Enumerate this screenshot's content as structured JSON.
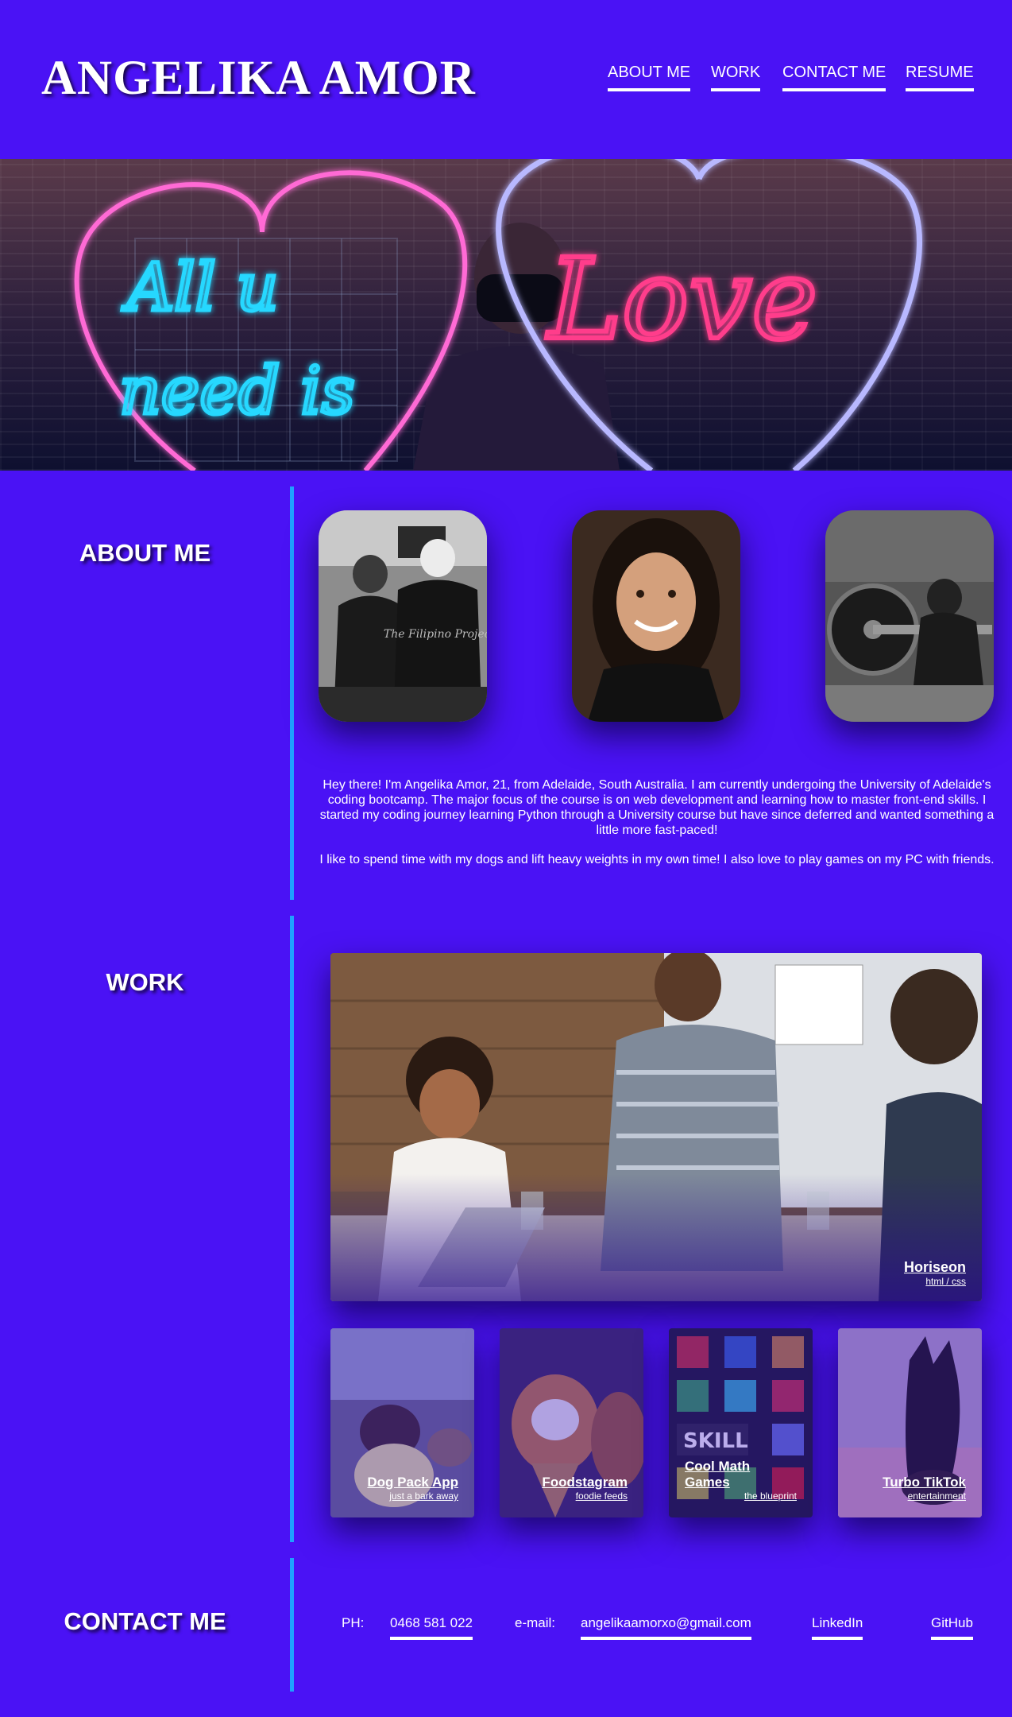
{
  "header": {
    "brand": "ANGELIKA AMOR",
    "nav": [
      "ABOUT ME",
      "WORK",
      "CONTACT ME",
      "RESUME"
    ]
  },
  "hero": {
    "neon_left_text_1": "All u",
    "neon_left_text_2": "need is",
    "neon_right_text": "Love"
  },
  "about": {
    "title": "ABOUT ME",
    "image_1_print": "The Filipino Project",
    "paragraph_1": "Hey there! I'm Angelika Amor, 21, from Adelaide, South Australia. I am currently undergoing the University of Adelaide's coding bootcamp. The major focus of the course is on web development and learning how to master front-end skills. I started my coding journey learning Python through a University course but have since deferred and wanted something a little more fast-paced!",
    "paragraph_2": "I like to spend time with my dogs and lift heavy weights in my own time! I also love to play games on my PC with friends."
  },
  "work": {
    "title": "WORK",
    "featured": {
      "name": "Horiseon",
      "tag": "html / css"
    },
    "projects": [
      {
        "name": "Dog Pack App",
        "tag": "just a bark away"
      },
      {
        "name": "Foodstagram",
        "tag": "foodie feeds"
      },
      {
        "name": "Cool Math Games",
        "tag": "the blueprint",
        "image_text": "SKILL"
      },
      {
        "name": "Turbo TikTok",
        "tag": "entertainment"
      }
    ]
  },
  "contact": {
    "title": "CONTACT ME",
    "phone_label": "PH:",
    "phone": "0468 581 022",
    "email_label": "e-mail:",
    "email": "angelikaamorxo@gmail.com",
    "linkedin": "LinkedIn",
    "github": "GitHub"
  },
  "colors": {
    "background": "#4a12f5",
    "divider": "#1fa0ff",
    "neon_blue": "#27d8ff",
    "neon_pink": "#ff3d8b"
  }
}
